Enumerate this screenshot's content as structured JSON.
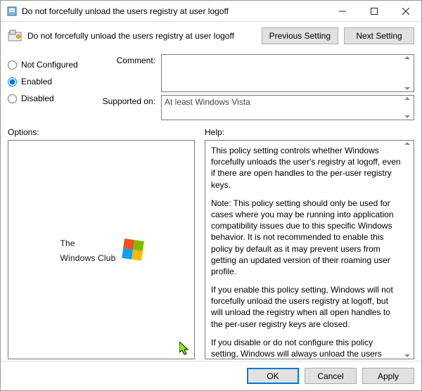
{
  "window": {
    "title": "Do not forcefully unload the users registry at user logoff"
  },
  "header": {
    "subtitle": "Do not forcefully unload the users registry at user logoff",
    "prev_label": "Previous Setting",
    "next_label": "Next Setting"
  },
  "state": {
    "options": {
      "not_configured": "Not Configured",
      "enabled": "Enabled",
      "disabled": "Disabled"
    },
    "selected": "enabled",
    "comment_label": "Comment:",
    "comment_value": "",
    "supported_label": "Supported on:",
    "supported_value": "At least Windows Vista"
  },
  "labels": {
    "options": "Options:",
    "help": "Help:"
  },
  "logo": {
    "line1": "The",
    "line2": "Windows Club"
  },
  "help": {
    "p1": "This policy setting  controls whether Windows forcefully unloads the user's registry at logoff, even if there are open handles to the per-user registry keys.",
    "p2": "Note: This policy setting should only be used for cases where you may be running into application compatibility issues due to this specific Windows behavior. It is not recommended to enable this policy by default as it may prevent users from getting an updated version of their roaming user profile.",
    "p3": "If you enable this policy setting, Windows will not forcefully unload the users registry at logoff, but will unload the registry when all open handles to the per-user registry keys are closed.",
    "p4": "If you disable or do not configure this policy setting, Windows will always unload the users registry at logoff, even if there are any open handles to the per-user registry keys at user logoff."
  },
  "footer": {
    "ok": "OK",
    "cancel": "Cancel",
    "apply": "Apply"
  }
}
